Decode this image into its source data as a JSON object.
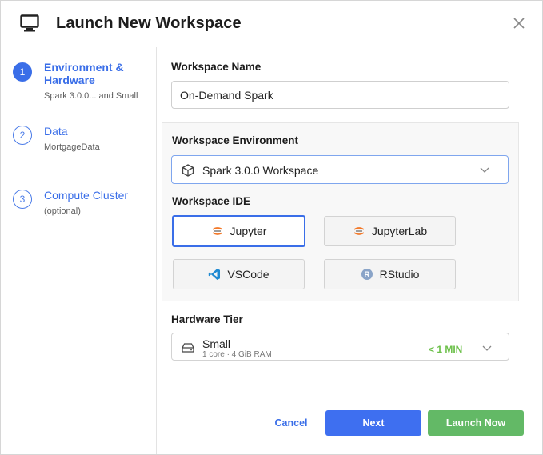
{
  "dialog": {
    "title": "Launch New Workspace"
  },
  "steps": [
    {
      "number": "1",
      "title": "Environment & Hardware",
      "subtitle": "Spark 3.0.0... and Small"
    },
    {
      "number": "2",
      "title": "Data",
      "subtitle": "MortgageData"
    },
    {
      "number": "3",
      "title": "Compute Cluster",
      "subtitle": "(optional)"
    }
  ],
  "form": {
    "workspace_name_label": "Workspace Name",
    "workspace_name_value": "On-Demand Spark",
    "environment_label": "Workspace Environment",
    "environment_value": "Spark 3.0.0 Workspace",
    "ide_label": "Workspace IDE",
    "ide_options": [
      {
        "label": "Jupyter",
        "icon": "jupyter-icon",
        "selected": true
      },
      {
        "label": "JupyterLab",
        "icon": "jupyterlab-icon",
        "selected": false
      },
      {
        "label": "VSCode",
        "icon": "vscode-icon",
        "selected": false
      },
      {
        "label": "RStudio",
        "icon": "rstudio-icon",
        "selected": false
      }
    ],
    "hardware_label": "Hardware Tier",
    "hardware_name": "Small",
    "hardware_spec": "1 core · 4 GiB RAM",
    "hardware_time": "< 1 MIN"
  },
  "footer": {
    "cancel_label": "Cancel",
    "next_label": "Next",
    "launch_label": "Launch Now"
  },
  "colors": {
    "accent": "#3a6ee8",
    "success": "#63b966",
    "time_badge": "#6cc04a"
  }
}
